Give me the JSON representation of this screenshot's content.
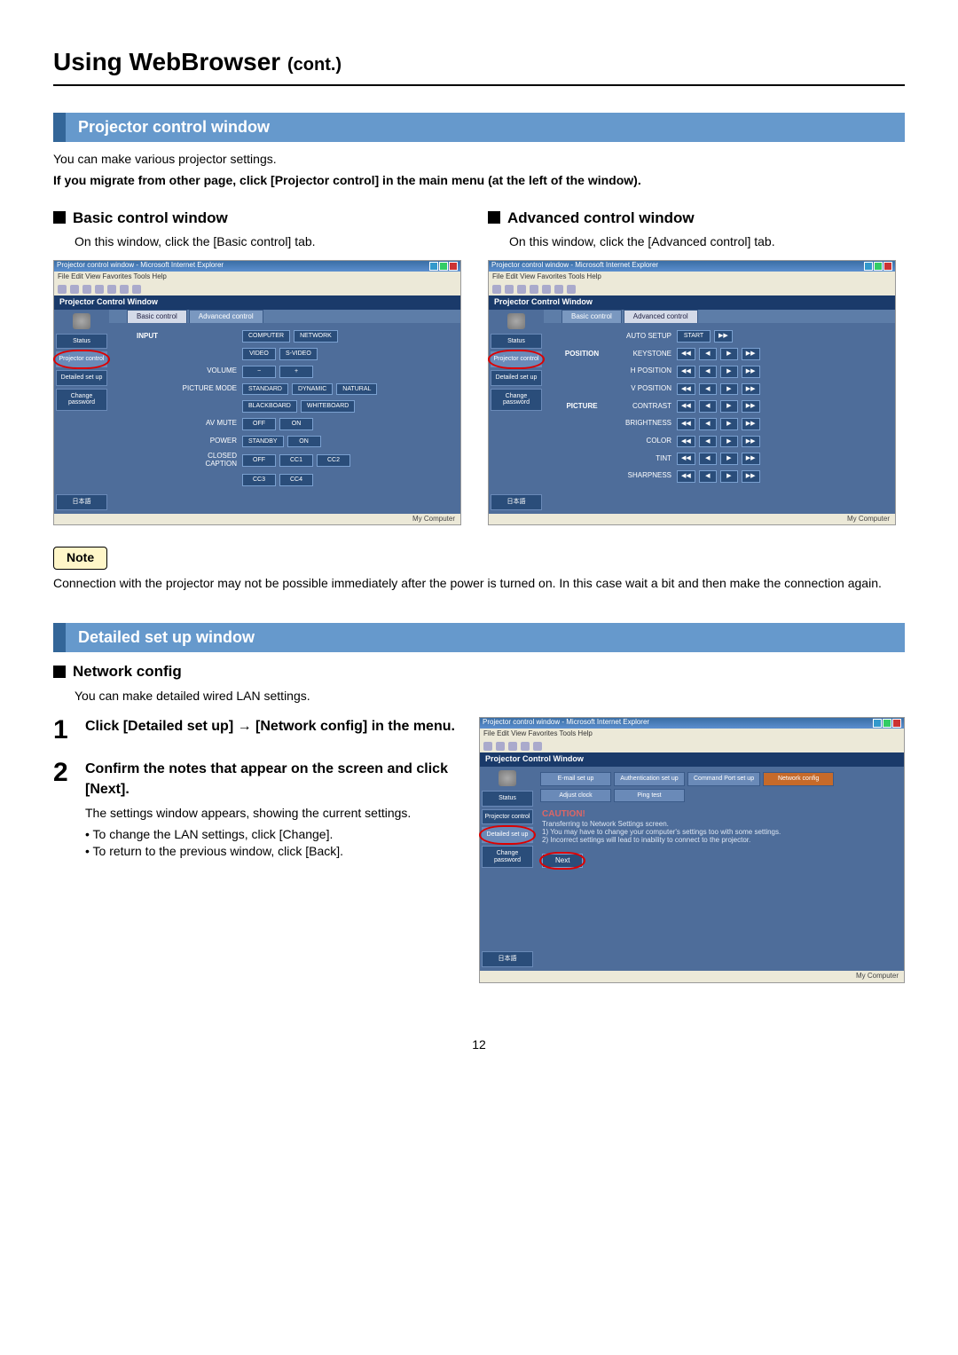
{
  "page": {
    "title": "Using WebBrowser",
    "title_suffix": "(cont.)",
    "number": "12"
  },
  "section1": {
    "bar": "Projector control window",
    "intro1": "You can make various projector settings.",
    "intro2": "If you migrate from other page, click [Projector control] in the main menu (at the left of the window).",
    "basic": {
      "head": "Basic control window",
      "desc": "On this window, click the [Basic control] tab."
    },
    "advanced": {
      "head": "Advanced control window",
      "desc": "On this window, click the [Advanced control] tab."
    }
  },
  "browser_common": {
    "wintitle": "Projector control window - Microsoft Internet Explorer",
    "menubar": "File  Edit  View  Favorites  Tools  Help",
    "header": "Projector Control Window",
    "status": "My Computer",
    "sidebar": {
      "status": "Status",
      "projector": "Projector control",
      "detailed": "Detailed set up",
      "change": "Change password",
      "lang": "日本語"
    },
    "tabs": {
      "basic": "Basic control",
      "advanced": "Advanced control"
    }
  },
  "basic_panel": {
    "rows": [
      {
        "cat": "INPUT",
        "labels": [
          ""
        ],
        "btn_rows": [
          [
            "COMPUTER",
            "NETWORK"
          ],
          [
            "VIDEO",
            "S-VIDEO"
          ]
        ]
      },
      {
        "cat": "",
        "labels": [
          "VOLUME"
        ],
        "btn_rows": [
          [
            "−",
            "+"
          ]
        ]
      },
      {
        "cat": "",
        "labels": [
          "PICTURE MODE"
        ],
        "btn_rows": [
          [
            "STANDARD",
            "DYNAMIC",
            "NATURAL"
          ],
          [
            "BLACKBOARD",
            "WHITEBOARD"
          ]
        ]
      },
      {
        "cat": "",
        "labels": [
          "AV MUTE"
        ],
        "btn_rows": [
          [
            "OFF",
            "ON"
          ]
        ]
      },
      {
        "cat": "",
        "labels": [
          "POWER"
        ],
        "btn_rows": [
          [
            "STANDBY",
            "ON"
          ]
        ]
      },
      {
        "cat": "",
        "labels": [
          "CLOSED CAPTION"
        ],
        "btn_rows": [
          [
            "OFF",
            "CC1",
            "CC2"
          ],
          [
            "CC3",
            "CC4"
          ]
        ]
      }
    ]
  },
  "adv_panel": {
    "cat1": "POSITION",
    "cat2": "PICTURE",
    "rows": [
      {
        "label": "AUTO SETUP",
        "btns": [
          "START"
        ],
        "arrows": false,
        "extra": "▶▶"
      },
      {
        "label": "KEYSTONE",
        "arrows": true
      },
      {
        "label": "H POSITION",
        "arrows": true
      },
      {
        "label": "V POSITION",
        "arrows": true
      },
      {
        "label": "CONTRAST",
        "arrows": true
      },
      {
        "label": "BRIGHTNESS",
        "arrows": true
      },
      {
        "label": "COLOR",
        "arrows": true
      },
      {
        "label": "TINT",
        "arrows": true
      },
      {
        "label": "SHARPNESS",
        "arrows": true
      }
    ],
    "arrow_labels": [
      "◀◀",
      "◀",
      "▶",
      "▶▶"
    ]
  },
  "note": {
    "label": "Note",
    "text": "Connection with the projector may not be possible immediately after the power is turned on. In this case wait a bit and then make the connection again."
  },
  "section2": {
    "bar": "Detailed set up window",
    "head": "Network config",
    "desc": "You can make detailed wired LAN settings."
  },
  "steps": {
    "s1": {
      "num": "1",
      "title": "Click [Detailed set up] → [Network config] in the menu."
    },
    "s2": {
      "num": "2",
      "title": "Confirm the notes that appear on the screen and click [Next].",
      "line1": "The settings window appears, showing the current settings.",
      "li1": "To change the LAN settings, click [Change].",
      "li2": "To return to the previous window, click [Back]."
    }
  },
  "detail_panel": {
    "tabs": [
      "E-mail set up",
      "Authentication set up",
      "Command Port set up",
      "Network config",
      "Adjust clock",
      "Ping test"
    ],
    "active": "Network config",
    "caution": "CAUTION!",
    "note_head": "Transferring to Network Settings screen.",
    "note1": "1) You may have to change your computer's settings too with some settings.",
    "note2": "2) Incorrect settings will lead to inability to connect to the projector.",
    "next": "Next"
  }
}
